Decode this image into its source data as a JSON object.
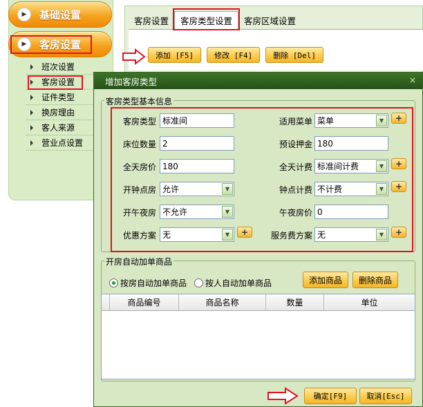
{
  "nav": {
    "primary": [
      {
        "label": "基础设置",
        "icon": "play-circle-icon"
      },
      {
        "label": "客房设置",
        "icon": "play-circle-icon"
      }
    ],
    "sub_items": [
      "班次设置",
      "客房设置",
      "证件类型",
      "换房理由",
      "客人来源",
      "营业点设置"
    ]
  },
  "tabs": [
    "客房设置",
    "客房类型设置",
    "客房区域设置"
  ],
  "toolbar": {
    "add": "添加 [F5]",
    "edit": "修改 [F4]",
    "delete": "删除 [Del]"
  },
  "dialog": {
    "title": "增加客房类型",
    "close": "×",
    "basic_group": "客房类型基本信息",
    "fields": {
      "room_type": {
        "label": "客房类型",
        "value": "标准间"
      },
      "menu": {
        "label": "适用菜单",
        "value": "菜单"
      },
      "beds": {
        "label": "床位数量",
        "value": "2"
      },
      "deposit": {
        "label": "预设押金",
        "value": "180"
      },
      "day_price": {
        "label": "全天房价",
        "value": "180"
      },
      "day_billing": {
        "label": "全天计费",
        "value": "标准间计费"
      },
      "hourly_room": {
        "label": "开钟点房",
        "value": "允许"
      },
      "hourly_billing": {
        "label": "钟点计费",
        "value": "不计费"
      },
      "midnight_room": {
        "label": "开午夜房",
        "value": "不允许"
      },
      "midnight_price": {
        "label": "午夜房价",
        "value": "0"
      },
      "discount": {
        "label": "优惠方案",
        "value": "无"
      },
      "service_fee": {
        "label": "服务费方案",
        "value": "无"
      }
    },
    "plus": "+",
    "goods_group": "开房自动加单商品",
    "radio_room": "按房自动加单商品",
    "radio_person": "按人自动加单商品",
    "add_goods": "添加商品",
    "remove_goods": "删除商品",
    "columns": [
      "商品编号",
      "商品名称",
      "数量",
      "单位"
    ],
    "ok": "确定[F9]",
    "cancel": "取消[Esc]"
  },
  "colors": {
    "highlight": "#e0121f",
    "accent": "#f5a31f",
    "title_bar": "#2f5f1f"
  }
}
